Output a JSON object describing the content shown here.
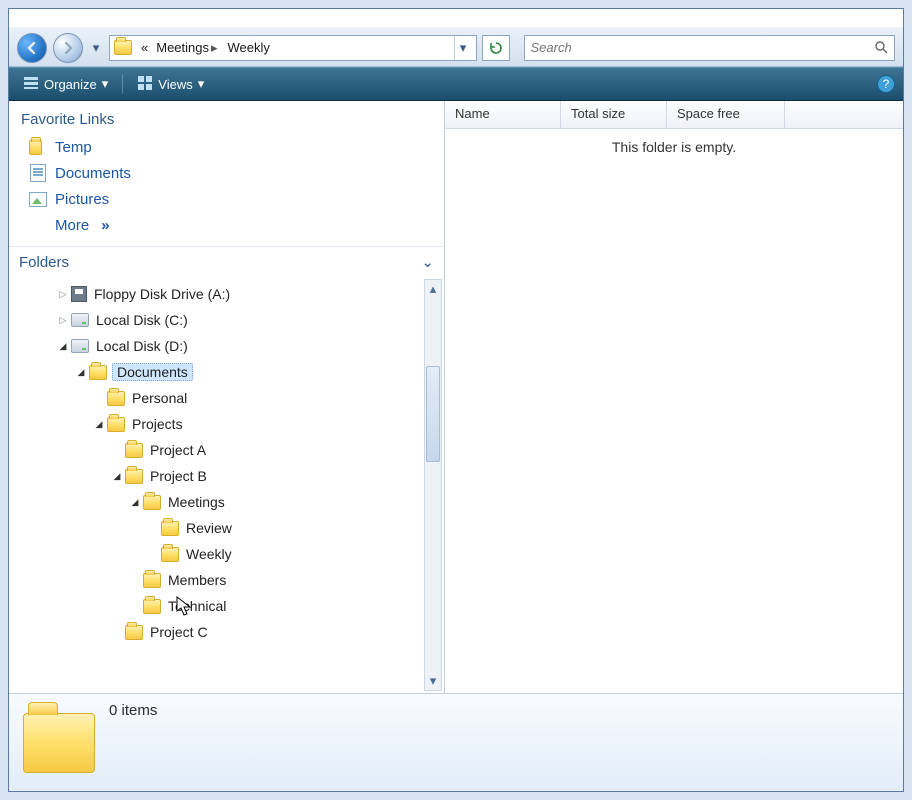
{
  "window_controls": {
    "minimize": "–",
    "maximize": "□",
    "close": "✕"
  },
  "breadcrumb": {
    "overflow": "«",
    "items": [
      "Meetings",
      "Weekly"
    ]
  },
  "search": {
    "placeholder": "Search"
  },
  "commandbar": {
    "organize": "Organize",
    "views": "Views"
  },
  "favorites": {
    "header": "Favorite Links",
    "items": [
      "Temp",
      "Documents",
      "Pictures"
    ],
    "more": "More"
  },
  "folders_header": "Folders",
  "tree": [
    {
      "depth": 0,
      "toggle": "closed",
      "icon": "floppy",
      "label": "Floppy Disk Drive (A:)"
    },
    {
      "depth": 0,
      "toggle": "closed",
      "icon": "drive",
      "label": "Local Disk (C:)"
    },
    {
      "depth": 0,
      "toggle": "open",
      "icon": "drive",
      "label": "Local Disk (D:)"
    },
    {
      "depth": 1,
      "toggle": "open",
      "icon": "folder",
      "label": "Documents",
      "selected": true
    },
    {
      "depth": 2,
      "toggle": "none",
      "icon": "folder",
      "label": "Personal"
    },
    {
      "depth": 2,
      "toggle": "open",
      "icon": "folder",
      "label": "Projects"
    },
    {
      "depth": 3,
      "toggle": "none",
      "icon": "folder",
      "label": "Project A"
    },
    {
      "depth": 3,
      "toggle": "open",
      "icon": "folder",
      "label": "Project B"
    },
    {
      "depth": 4,
      "toggle": "open",
      "icon": "folder",
      "label": "Meetings"
    },
    {
      "depth": 5,
      "toggle": "none",
      "icon": "folder",
      "label": "Review"
    },
    {
      "depth": 5,
      "toggle": "none",
      "icon": "folder",
      "label": "Weekly"
    },
    {
      "depth": 4,
      "toggle": "none",
      "icon": "folder",
      "label": "Members"
    },
    {
      "depth": 4,
      "toggle": "none",
      "icon": "folder",
      "label": "Technical"
    },
    {
      "depth": 3,
      "toggle": "none",
      "icon": "folder",
      "label": "Project C"
    }
  ],
  "columns": [
    "Name",
    "Total size",
    "Space free"
  ],
  "empty_message": "This folder is empty.",
  "details": {
    "items_text": "0 items"
  }
}
